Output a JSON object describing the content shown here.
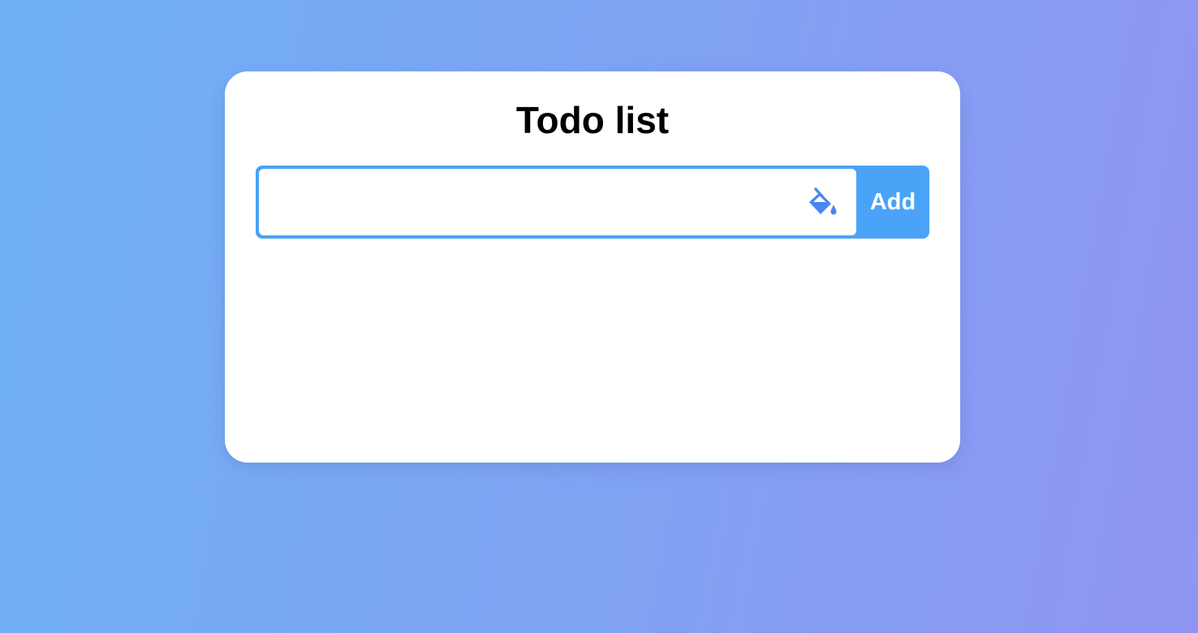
{
  "app": {
    "title": "Todo list"
  },
  "input": {
    "value": "",
    "placeholder": ""
  },
  "buttons": {
    "add_label": "Add"
  },
  "icons": {
    "paint": "paint-bucket-icon"
  },
  "todos": [],
  "colors": {
    "accent": "#4aa3f7",
    "background_start": "#6fb1f6",
    "background_end": "#8f95f3",
    "card": "#ffffff",
    "title": "#000000"
  }
}
